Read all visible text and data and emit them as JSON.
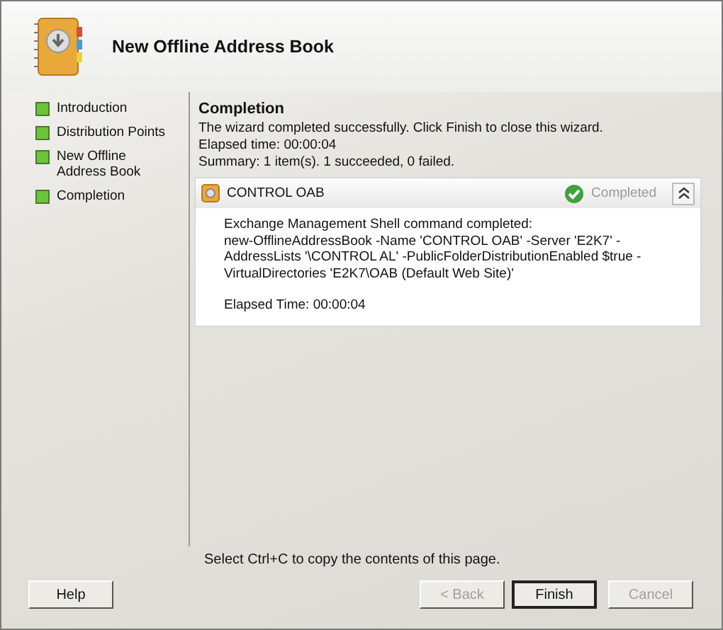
{
  "window": {
    "title": "New Offline Address Book"
  },
  "steps": [
    {
      "label": "Introduction",
      "completed": true
    },
    {
      "label": "Distribution Points",
      "completed": true
    },
    {
      "label": "New Offline Address Book",
      "completed": true
    },
    {
      "label": "Completion",
      "completed": true
    }
  ],
  "page": {
    "heading": "Completion",
    "message": "The wizard completed successfully. Click Finish to close this wizard.",
    "elapsed": "Elapsed time: 00:00:04",
    "summary": "Summary: 1 item(s). 1 succeeded, 0 failed."
  },
  "result": {
    "name": "CONTROL OAB",
    "status": "Completed",
    "succeeded": true,
    "expanded": true,
    "lines": [
      "Exchange Management Shell command completed:",
      "new-OfflineAddressBook -Name 'CONTROL OAB' -Server 'E2K7' -AddressLists '\\CONTROL AL' -PublicFolderDistributionEnabled $true -VirtualDirectories 'E2K7\\OAB (Default Web Site)'"
    ],
    "elapsed": "Elapsed Time: 00:00:04"
  },
  "hint": "Select Ctrl+C to copy the contents of this page.",
  "buttons": [
    {
      "label": "Help",
      "disabled": false,
      "default": false
    },
    {
      "label": "< Back",
      "disabled": true,
      "default": false
    },
    {
      "label": "Finish",
      "disabled": false,
      "default": true
    },
    {
      "label": "Cancel",
      "disabled": true,
      "default": false
    }
  ]
}
